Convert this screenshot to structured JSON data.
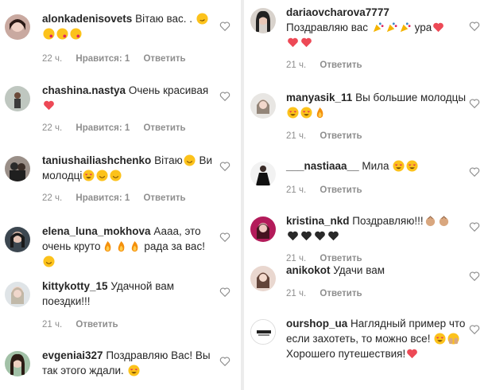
{
  "left": [
    {
      "user": "alonkadenisovets",
      "text": "Вітаю вас. .",
      "time": "22 ч.",
      "likes": "Нравится: 1",
      "reply": "Ответить"
    },
    {
      "user": "chashina.nastya",
      "text": "Очень красивая",
      "time": "22 ч.",
      "likes": "Нравится: 1",
      "reply": "Ответить"
    },
    {
      "user": "taniushailiashchenko",
      "text": "Вітаю",
      "text2": "Ви молодці",
      "time": "22 ч.",
      "likes": "Нравится: 1",
      "reply": "Ответить"
    },
    {
      "user": "elena_luna_mokhova",
      "text": "Аааа, это очень круто",
      "text2": "рада за вас!",
      "time": "",
      "likes": "",
      "reply": ""
    },
    {
      "user": "kittykotty_15",
      "text": "Удачной вам поездки!!!",
      "time": "21 ч.",
      "likes": "",
      "reply": "Ответить"
    },
    {
      "user": "evgeniai327",
      "text": "Поздравляю Вас! Вы так этого ждали.",
      "time": "",
      "likes": "",
      "reply": ""
    }
  ],
  "right": [
    {
      "user": "dariaovcharova7777",
      "text": "Поздравляю вас",
      "text2": "ура",
      "time": "21 ч.",
      "reply": "Ответить"
    },
    {
      "user": "manyasik_11",
      "text": "Вы большие молодцы",
      "time": "21 ч.",
      "reply": "Ответить"
    },
    {
      "user": "___nastiaaa__",
      "text": "Мила",
      "time": "21 ч.",
      "reply": "Ответить"
    },
    {
      "user": "kristina_nkd",
      "text": "Поздравляю!!!",
      "time": "21 ч.",
      "reply": "Ответить"
    },
    {
      "user": "anikokot",
      "text": "Удачи вам",
      "time": "21 ч.",
      "reply": "Ответить"
    },
    {
      "user": "ourshop_ua",
      "text": "Наглядный пример что если захотеть, то можно все!",
      "text2": "Хорошего путешествия!",
      "time": "",
      "reply": ""
    }
  ],
  "colors": {
    "heart": "#ed4956",
    "meta": "#8e8e8e",
    "text": "#262626"
  }
}
